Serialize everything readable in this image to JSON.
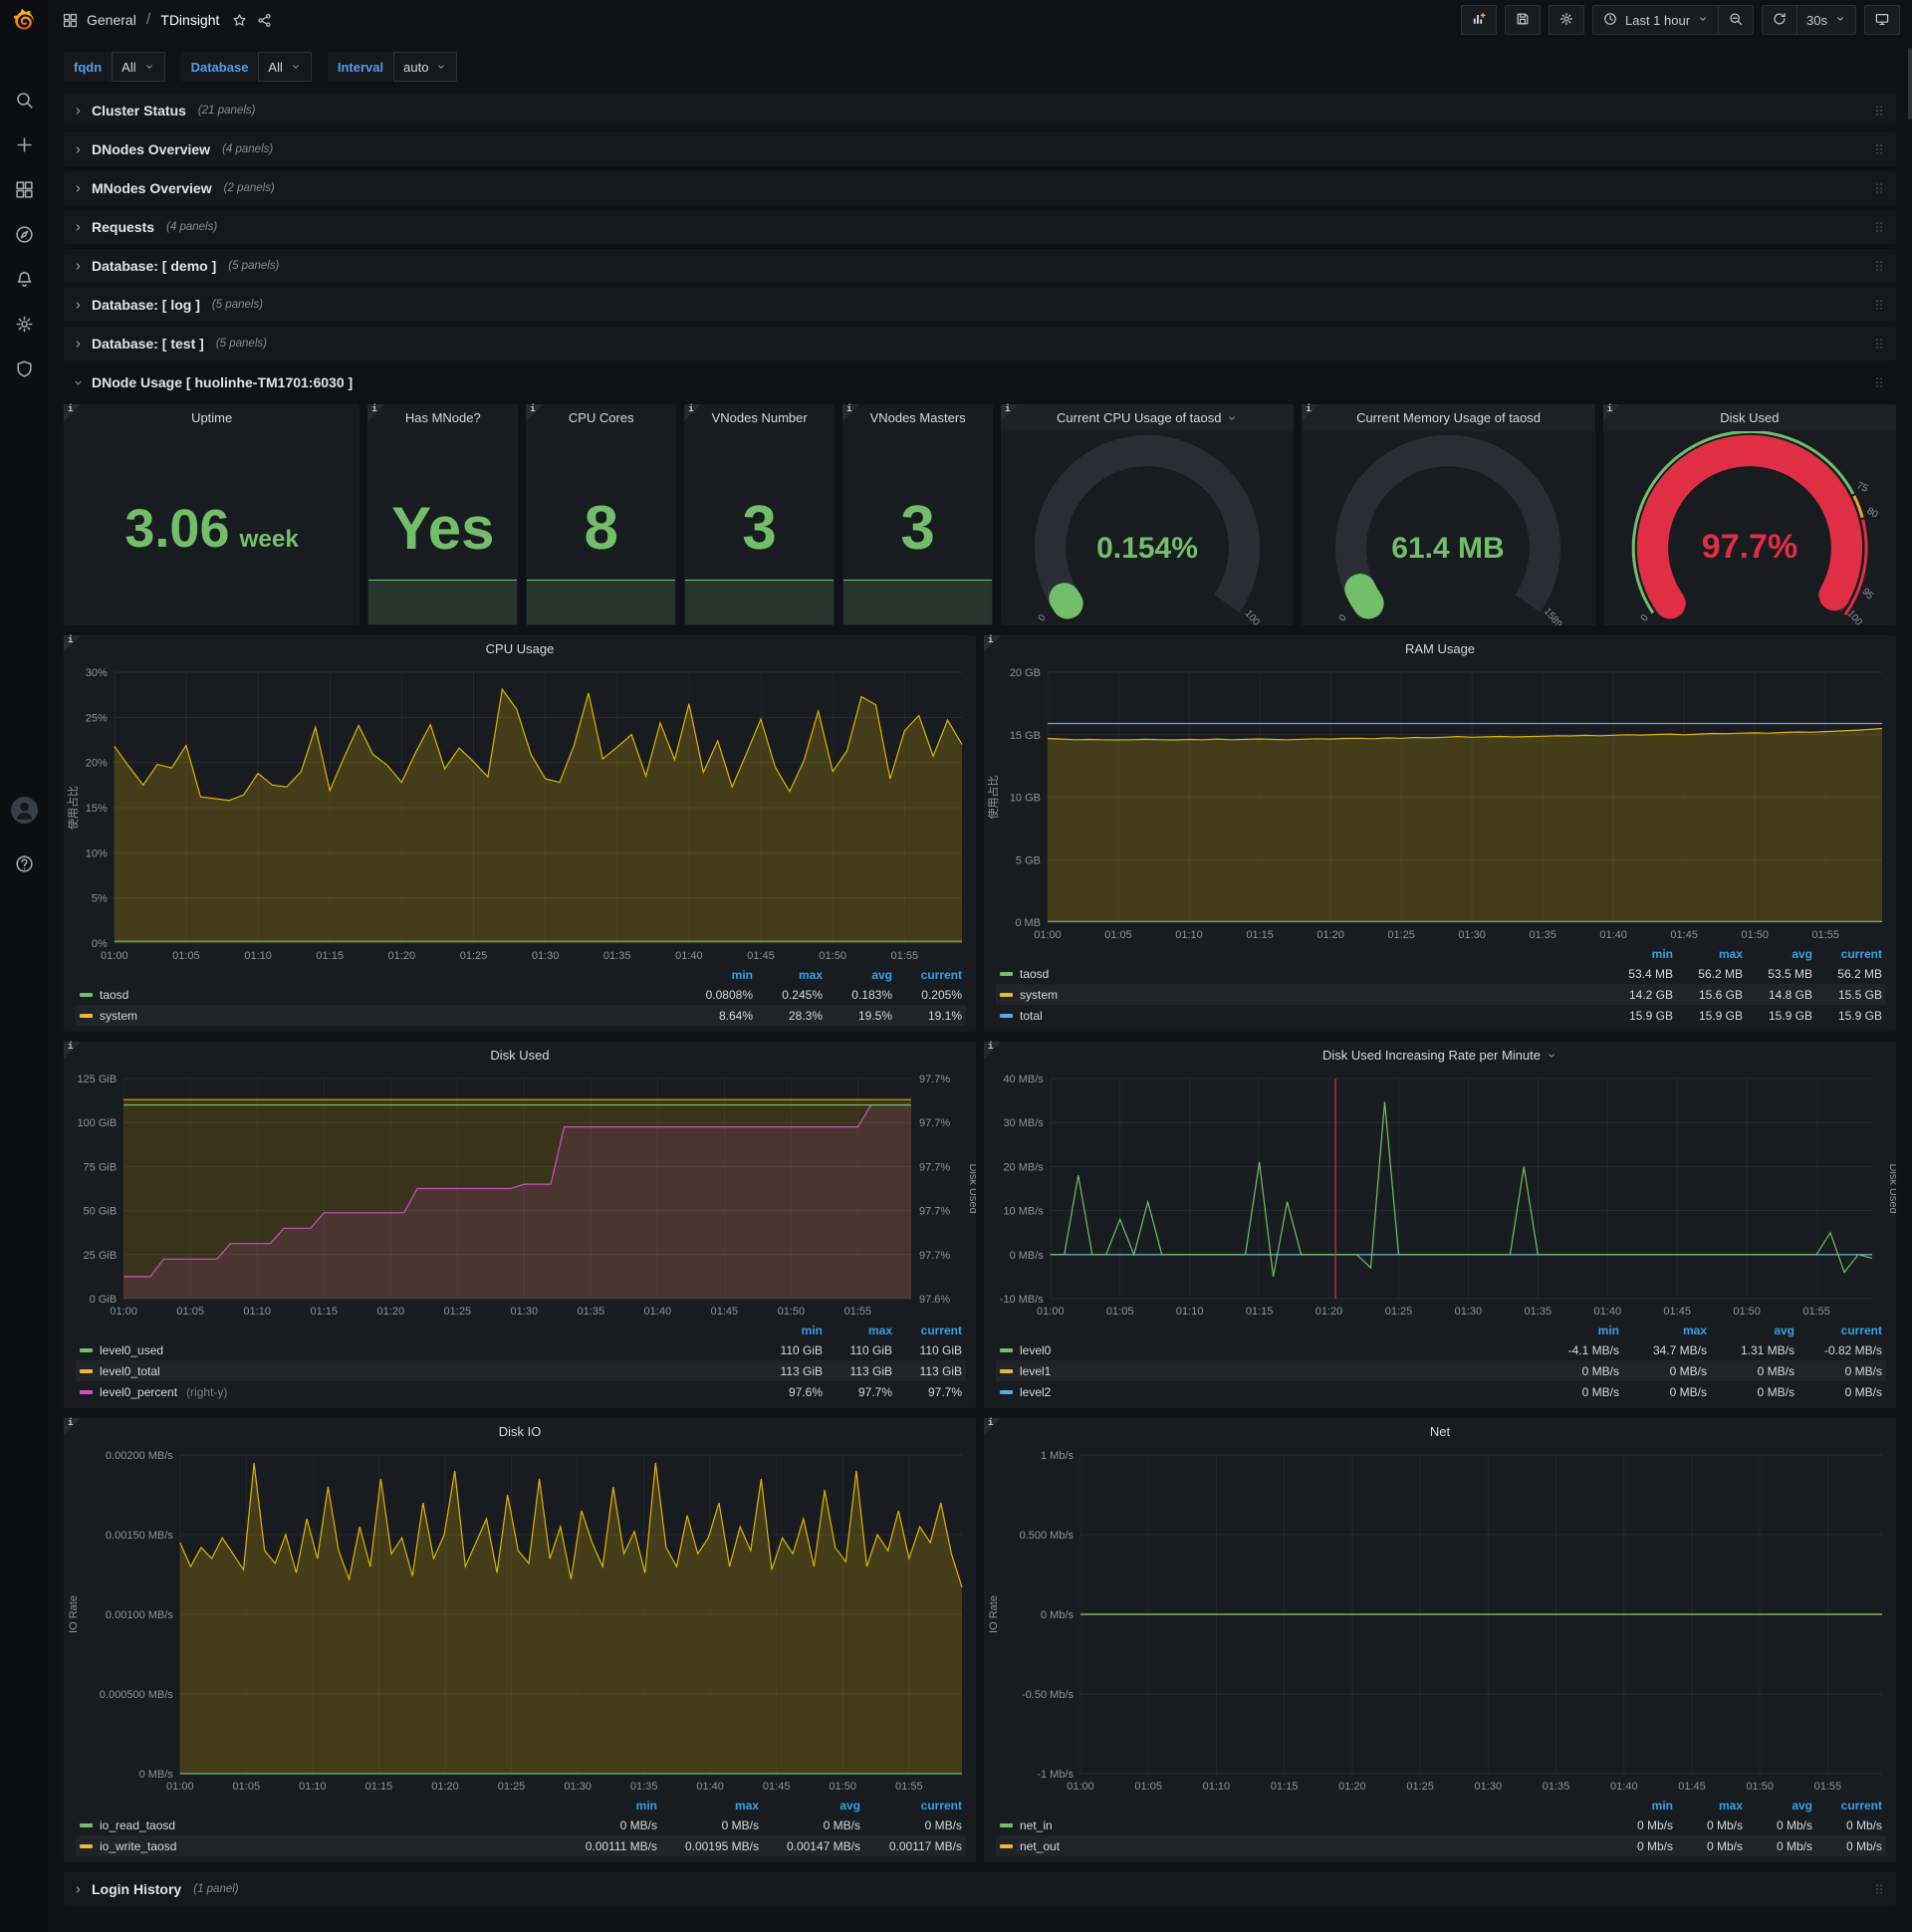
{
  "nav": {
    "breadcrumb_root": "General",
    "separator": "/",
    "dashboard_title": "TDinsight",
    "time_range": "Last 1 hour",
    "refresh_interval": "30s"
  },
  "sidebar": {
    "icons": [
      "search",
      "plus",
      "apps",
      "compass",
      "bell",
      "gear",
      "shield"
    ],
    "bottom_icons": [
      "user",
      "help"
    ]
  },
  "variables": [
    {
      "label": "fqdn",
      "value": "All"
    },
    {
      "label": "Database",
      "value": "All"
    },
    {
      "label": "Interval",
      "value": "auto"
    }
  ],
  "rows_top": [
    {
      "title": "Cluster Status",
      "count": "(21 panels)"
    },
    {
      "title": "DNodes Overview",
      "count": "(4 panels)"
    },
    {
      "title": "MNodes Overview",
      "count": "(2 panels)"
    },
    {
      "title": "Requests",
      "count": "(4 panels)"
    },
    {
      "title": "Database: [ demo ]",
      "count": "(5 panels)"
    },
    {
      "title": "Database: [ log ]",
      "count": "(5 panels)"
    },
    {
      "title": "Database: [ test ]",
      "count": "(5 panels)"
    }
  ],
  "expanded_row": {
    "title": "DNode Usage [ huolinhe-TM1701:6030 ]"
  },
  "rows_bottom": [
    {
      "title": "Login History",
      "count": "(1 panel)"
    }
  ],
  "stats": [
    {
      "title": "Uptime",
      "value": "3.06",
      "unit": "week",
      "sparkline": false,
      "size": 54
    },
    {
      "title": "Has MNode?",
      "value": "Yes",
      "unit": "",
      "sparkline": true,
      "size": 60
    },
    {
      "title": "CPU Cores",
      "value": "8",
      "unit": "",
      "sparkline": true,
      "size": 62
    },
    {
      "title": "VNodes Number",
      "value": "3",
      "unit": "",
      "sparkline": true,
      "size": 62
    },
    {
      "title": "VNodes Masters",
      "value": "3",
      "unit": "",
      "sparkline": true,
      "size": 62
    }
  ],
  "gauges": [
    {
      "title": "Current CPU Usage of taosd",
      "dropdown": true,
      "value": "0.154%",
      "arc_pct": 0.154,
      "value_color": "#73bf69",
      "bar_color": "#73bf69",
      "value_size": 30,
      "ticks": [
        {
          "label": "0",
          "pct": 0
        },
        {
          "label": "100",
          "pct": 100
        }
      ]
    },
    {
      "title": "Current Memory Usage of taosd",
      "dropdown": false,
      "value": "61.4 MB",
      "arc_pct": 3.86,
      "value_color": "#73bf69",
      "bar_color": "#73bf69",
      "value_size": 30,
      "ticks": [
        {
          "label": "0",
          "pct": 0
        },
        {
          "label": "1589",
          "pct": 100
        }
      ]
    },
    {
      "title": "Disk Used",
      "dropdown": false,
      "value": "97.7%",
      "arc_pct": 97.7,
      "value_color": "#e02f44",
      "bar_color": "#e02f44",
      "value_size": 34,
      "thresholds": [
        {
          "to": 75,
          "color": "#73bf69"
        },
        {
          "to": 80,
          "color": "#f0a32f"
        },
        {
          "to": 100,
          "color": "#e02f44"
        }
      ],
      "ticks": [
        {
          "label": "0",
          "pct": 0
        },
        {
          "label": "75",
          "pct": 75
        },
        {
          "label": "80",
          "pct": 80
        },
        {
          "label": "95",
          "pct": 95
        },
        {
          "label": "100",
          "pct": 100
        }
      ]
    }
  ],
  "chart_data": [
    {
      "type": "line",
      "title": "CPU Usage",
      "dropdown": false,
      "ylabel": "使用占比",
      "grid": true,
      "legend_position": "bottom",
      "yticks": [
        "30%",
        "25%",
        "20%",
        "15%",
        "10%",
        "5%",
        "0%"
      ],
      "ylim": [
        0,
        30
      ],
      "xticks": [
        "01:00",
        "01:05",
        "01:10",
        "01:15",
        "01:20",
        "01:25",
        "01:30",
        "01:35",
        "01:40",
        "01:45",
        "01:50",
        "01:55"
      ],
      "series": [
        {
          "name": "system",
          "color": "#e0b400",
          "fill": 0.22,
          "values": [
            21.8,
            19.6,
            17.5,
            19.8,
            19.4,
            21.9,
            16.2,
            16.0,
            15.8,
            16.4,
            18.8,
            17.5,
            17.3,
            19.0,
            23.9,
            16.9,
            20.6,
            24.1,
            20.9,
            19.7,
            17.8,
            21.2,
            24.2,
            19.3,
            21.6,
            20.1,
            18.4,
            28.1,
            25.9,
            20.9,
            18.2,
            17.8,
            21.9,
            27.7,
            20.4,
            21.7,
            23.1,
            18.5,
            24.4,
            20.3,
            26.5,
            18.9,
            22.4,
            17.3,
            21.0,
            24.8,
            19.5,
            16.8,
            20.2,
            25.7,
            19.0,
            21.3,
            27.3,
            26.4,
            18.2,
            23.5,
            25.2,
            20.7,
            24.7,
            22.0
          ]
        },
        {
          "name": "taosd",
          "color": "#73bf69",
          "fill": 0,
          "values": [
            0.2,
            0.2
          ]
        }
      ],
      "legend": {
        "headers": [
          "min",
          "max",
          "avg",
          "current"
        ],
        "rows": [
          {
            "name": "taosd",
            "color": "#73bf69",
            "values": [
              "0.0808%",
              "0.245%",
              "0.183%",
              "0.205%"
            ]
          },
          {
            "name": "system",
            "color": "#eab839",
            "values": [
              "8.64%",
              "28.3%",
              "19.5%",
              "19.1%"
            ]
          }
        ]
      }
    },
    {
      "type": "line",
      "title": "RAM Usage",
      "dropdown": false,
      "ylabel": "使用占比",
      "grid": true,
      "yticks": [
        "20 GB",
        "15 GB",
        "10 GB",
        "5 GB",
        "0 MB"
      ],
      "ylim": [
        0,
        20
      ],
      "xticks": [
        "01:00",
        "01:05",
        "01:10",
        "01:15",
        "01:20",
        "01:25",
        "01:30",
        "01:35",
        "01:40",
        "01:45",
        "01:50",
        "01:55"
      ],
      "series": [
        {
          "name": "system",
          "color": "#e0b400",
          "fill": 0.22,
          "values": [
            14.7,
            14.65,
            14.6,
            14.62,
            14.6,
            14.58,
            14.6,
            14.63,
            14.6,
            14.58,
            14.62,
            14.6,
            14.65,
            14.6,
            14.63,
            14.66,
            14.62,
            14.6,
            14.64,
            14.68,
            14.65,
            14.7,
            14.72,
            14.68,
            14.75,
            14.72,
            14.78,
            14.75,
            14.8,
            14.85,
            14.8,
            14.83,
            14.86,
            14.82,
            14.85,
            14.88,
            14.92,
            14.9,
            14.95,
            14.92,
            14.96,
            15.0,
            14.97,
            15.02,
            15.05,
            15.0,
            15.05,
            15.1,
            15.08,
            15.12,
            15.15,
            15.12,
            15.18,
            15.22,
            15.2,
            15.25,
            15.3,
            15.35,
            15.42,
            15.5
          ]
        },
        {
          "name": "total",
          "color": "#56a9e4",
          "fill": 0,
          "values": [
            15.9,
            15.9
          ]
        },
        {
          "name": "taosd",
          "color": "#73bf69",
          "fill": 0,
          "values": [
            0.055,
            0.055
          ]
        }
      ],
      "legend": {
        "headers": [
          "min",
          "max",
          "avg",
          "current"
        ],
        "rows": [
          {
            "name": "taosd",
            "color": "#73bf69",
            "values": [
              "53.4 MB",
              "56.2 MB",
              "53.5 MB",
              "56.2 MB"
            ]
          },
          {
            "name": "system",
            "color": "#eab839",
            "values": [
              "14.2 GB",
              "15.6 GB",
              "14.8 GB",
              "15.5 GB"
            ]
          },
          {
            "name": "total",
            "color": "#56a9e4",
            "values": [
              "15.9 GB",
              "15.9 GB",
              "15.9 GB",
              "15.9 GB"
            ]
          }
        ]
      }
    },
    {
      "type": "line",
      "title": "Disk Used",
      "dropdown": false,
      "right_label": "Disk Used",
      "grid": true,
      "yticks": [
        "125 GiB",
        "100 GiB",
        "75 GiB",
        "50 GiB",
        "25 GiB",
        "0 GiB"
      ],
      "ylim": [
        0,
        125
      ],
      "right_yticks": [
        "97.7%",
        "97.7%",
        "97.7%",
        "97.7%",
        "97.7%",
        "97.6%"
      ],
      "right_ylim": [
        97.6,
        97.7
      ],
      "xticks": [
        "01:00",
        "01:05",
        "01:10",
        "01:15",
        "01:20",
        "01:25",
        "01:30",
        "01:35",
        "01:40",
        "01:45",
        "01:50",
        "01:55"
      ],
      "series": [
        {
          "name": "level0_total",
          "color": "#e0b400",
          "fill": 0.16,
          "values": [
            113,
            113
          ]
        },
        {
          "name": "level0_percent",
          "color": "#cf51c3",
          "fill": 0.12,
          "axis": "right",
          "values": [
            97.61,
            97.61,
            97.61,
            97.618,
            97.618,
            97.618,
            97.618,
            97.618,
            97.625,
            97.625,
            97.625,
            97.625,
            97.632,
            97.632,
            97.632,
            97.639,
            97.639,
            97.639,
            97.639,
            97.639,
            97.639,
            97.639,
            97.65,
            97.65,
            97.65,
            97.65,
            97.65,
            97.65,
            97.65,
            97.65,
            97.652,
            97.652,
            97.652,
            97.678,
            97.678,
            97.678,
            97.678,
            97.678,
            97.678,
            97.678,
            97.678,
            97.678,
            97.678,
            97.678,
            97.678,
            97.678,
            97.678,
            97.678,
            97.678,
            97.678,
            97.678,
            97.678,
            97.678,
            97.678,
            97.678,
            97.678,
            97.688,
            97.688,
            97.688,
            97.688
          ]
        },
        {
          "name": "level0_used",
          "color": "#73bf69",
          "fill": 0,
          "values": [
            110,
            110
          ]
        }
      ],
      "legend": {
        "headers": [
          "min",
          "max",
          "current"
        ],
        "rows": [
          {
            "name": "level0_used",
            "color": "#73bf69",
            "values": [
              "110 GiB",
              "110 GiB",
              "110 GiB"
            ]
          },
          {
            "name": "level0_total",
            "color": "#eab839",
            "values": [
              "113 GiB",
              "113 GiB",
              "113 GiB"
            ]
          },
          {
            "name": "level0_percent",
            "color": "#cf51c3",
            "note": "(right-y)",
            "values": [
              "97.6%",
              "97.7%",
              "97.7%"
            ]
          }
        ]
      }
    },
    {
      "type": "line",
      "title": "Disk Used Increasing Rate per Minute",
      "dropdown": true,
      "right_label": "Disk Used",
      "grid": true,
      "yticks": [
        "40 MB/s",
        "30 MB/s",
        "20 MB/s",
        "10 MB/s",
        "0 MB/s",
        "-10 MB/s"
      ],
      "ylim": [
        -10,
        40
      ],
      "xticks": [
        "01:00",
        "01:05",
        "01:10",
        "01:15",
        "01:20",
        "01:25",
        "01:30",
        "01:35",
        "01:40",
        "01:45",
        "01:50",
        "01:55"
      ],
      "annotation": {
        "x": 0.347,
        "color": "#e02f44"
      },
      "series": [
        {
          "name": "level1",
          "color": "#e0b400",
          "fill": 0,
          "values": [
            0,
            0
          ]
        },
        {
          "name": "level2",
          "color": "#56a9e4",
          "fill": 0,
          "values": [
            0,
            0
          ]
        },
        {
          "name": "level0",
          "color": "#73bf69",
          "fill": 0,
          "values": [
            0,
            0,
            18,
            0,
            0,
            8,
            0,
            12,
            0,
            0,
            0,
            0,
            0,
            0,
            0,
            21,
            -5,
            12,
            0,
            0,
            0,
            0,
            0,
            -3,
            34.7,
            0,
            0,
            0,
            0,
            0,
            0,
            0,
            0,
            0,
            20,
            0,
            0,
            0,
            0,
            0,
            0,
            0,
            0,
            0,
            0,
            0,
            0,
            0,
            0,
            0,
            0,
            0,
            0,
            0,
            0,
            0,
            5,
            -4,
            0,
            -0.82
          ]
        }
      ],
      "legend": {
        "headers": [
          "min",
          "max",
          "avg",
          "current"
        ],
        "rows": [
          {
            "name": "level0",
            "color": "#73bf69",
            "values": [
              "-4.1 MB/s",
              "34.7 MB/s",
              "1.31 MB/s",
              "-0.82 MB/s"
            ]
          },
          {
            "name": "level1",
            "color": "#eab839",
            "values": [
              "0 MB/s",
              "0 MB/s",
              "0 MB/s",
              "0 MB/s"
            ]
          },
          {
            "name": "level2",
            "color": "#56a9e4",
            "values": [
              "0 MB/s",
              "0 MB/s",
              "0 MB/s",
              "0 MB/s"
            ]
          }
        ]
      }
    },
    {
      "type": "line",
      "title": "Disk IO",
      "dropdown": false,
      "ylabel": "IO Rate",
      "grid": true,
      "yticks": [
        "0.00200 MB/s",
        "0.00150 MB/s",
        "0.00100 MB/s",
        "0.000500 MB/s",
        "0 MB/s"
      ],
      "ylim": [
        0,
        0.002
      ],
      "xticks": [
        "01:00",
        "01:05",
        "01:10",
        "01:15",
        "01:20",
        "01:25",
        "01:30",
        "01:35",
        "01:40",
        "01:45",
        "01:50",
        "01:55"
      ],
      "series": [
        {
          "name": "io_write_taosd",
          "color": "#e0b400",
          "fill": 0.22,
          "values": [
            0.00145,
            0.0013,
            0.00142,
            0.00135,
            0.00148,
            0.00138,
            0.00128,
            0.00195,
            0.0014,
            0.00132,
            0.0015,
            0.00126,
            0.0016,
            0.00135,
            0.0018,
            0.0014,
            0.00122,
            0.00155,
            0.0013,
            0.00185,
            0.00138,
            0.00148,
            0.00124,
            0.0017,
            0.00135,
            0.0015,
            0.0019,
            0.0013,
            0.00145,
            0.0016,
            0.00126,
            0.00175,
            0.0014,
            0.00132,
            0.00185,
            0.00135,
            0.00155,
            0.00122,
            0.00165,
            0.00145,
            0.0013,
            0.0018,
            0.00138,
            0.00152,
            0.00126,
            0.00195,
            0.00142,
            0.0013,
            0.00162,
            0.00138,
            0.00148,
            0.0017,
            0.0013,
            0.00155,
            0.0014,
            0.00185,
            0.00128,
            0.00148,
            0.00138,
            0.0016,
            0.0013,
            0.00178,
            0.00142,
            0.00133,
            0.0019,
            0.0013,
            0.0015,
            0.0014,
            0.00165,
            0.00135,
            0.00155,
            0.00145,
            0.0017,
            0.00138,
            0.00117
          ]
        },
        {
          "name": "io_read_taosd",
          "color": "#73bf69",
          "fill": 0,
          "values": [
            0,
            0
          ]
        }
      ],
      "legend": {
        "headers": [
          "min",
          "max",
          "avg",
          "current"
        ],
        "rows": [
          {
            "name": "io_read_taosd",
            "color": "#73bf69",
            "values": [
              "0 MB/s",
              "0 MB/s",
              "0 MB/s",
              "0 MB/s"
            ]
          },
          {
            "name": "io_write_taosd",
            "color": "#eab839",
            "values": [
              "0.00111 MB/s",
              "0.00195 MB/s",
              "0.00147 MB/s",
              "0.00117 MB/s"
            ]
          }
        ]
      }
    },
    {
      "type": "line",
      "title": "Net",
      "dropdown": false,
      "ylabel": "IO Rate",
      "grid": true,
      "yticks": [
        "1 Mb/s",
        "0.500 Mb/s",
        "0 Mb/s",
        "-0.50 Mb/s",
        "-1 Mb/s"
      ],
      "ylim": [
        -1,
        1
      ],
      "xticks": [
        "01:00",
        "01:05",
        "01:10",
        "01:15",
        "01:20",
        "01:25",
        "01:30",
        "01:35",
        "01:40",
        "01:45",
        "01:50",
        "01:55"
      ],
      "series": [
        {
          "name": "net_out",
          "color": "#e0b400",
          "fill": 0,
          "values": [
            0,
            0
          ]
        },
        {
          "name": "net_in",
          "color": "#73bf69",
          "fill": 0,
          "values": [
            0,
            0
          ]
        }
      ],
      "legend": {
        "headers": [
          "min",
          "max",
          "avg",
          "current"
        ],
        "rows": [
          {
            "name": "net_in",
            "color": "#73bf69",
            "values": [
              "0 Mb/s",
              "0 Mb/s",
              "0 Mb/s",
              "0 Mb/s"
            ]
          },
          {
            "name": "net_out",
            "color": "#eab839",
            "values": [
              "0 Mb/s",
              "0 Mb/s",
              "0 Mb/s",
              "0 Mb/s"
            ]
          }
        ]
      }
    }
  ]
}
